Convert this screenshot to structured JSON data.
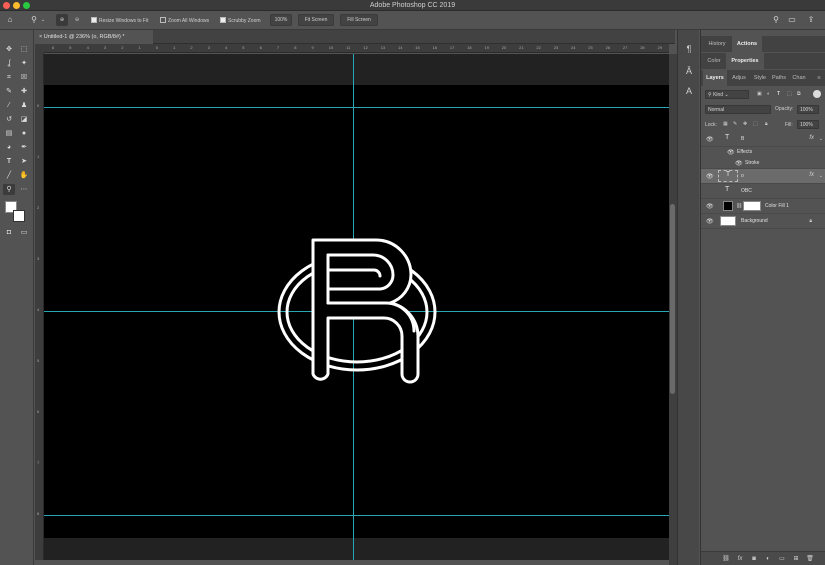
{
  "app": {
    "title": "Adobe Photoshop CC 2019"
  },
  "options_bar": {
    "resize_windows": {
      "label": "Resize Windows to Fit",
      "checked": true
    },
    "zoom_all": {
      "label": "Zoom All Windows",
      "checked": false
    },
    "scrubby_zoom": {
      "label": "Scrubby Zoom",
      "checked": true
    },
    "zoom_value": "100%",
    "fit_screen": "Fit Screen",
    "fill_screen": "Fill Screen"
  },
  "document": {
    "tab_title": "Untitled-1 @ 236% (o, RGB/8#) *"
  },
  "ruler": {
    "top": [
      "6",
      "5",
      "4",
      "3",
      "2",
      "1",
      "0",
      "1",
      "2",
      "3",
      "4",
      "5",
      "6",
      "7",
      "8",
      "9",
      "10",
      "11",
      "12",
      "13",
      "14",
      "15",
      "16",
      "17",
      "18",
      "19",
      "20",
      "21",
      "22",
      "23",
      "24",
      "25",
      "26",
      "27",
      "28",
      "29"
    ],
    "left": [
      "0",
      "1",
      "2",
      "3",
      "4",
      "5",
      "6",
      "7",
      "8",
      "9"
    ]
  },
  "top_panel": {
    "tabs": [
      "History",
      "Actions"
    ],
    "active": "Actions"
  },
  "mid_panel": {
    "tabs": [
      "Color",
      "Properties"
    ],
    "active": "Properties"
  },
  "layers_panel": {
    "tabs": [
      "Layers",
      "Adjus",
      "Style",
      "Paths",
      "Chan"
    ],
    "active": "Layers",
    "filter_kind": "Kind",
    "blend_mode": "Normal",
    "opacity_label": "Opacity:",
    "opacity_value": "100%",
    "lock_label": "Lock:",
    "fill_label": "Fill:",
    "fill_value": "100%",
    "layers": [
      {
        "name": "B",
        "type": "T",
        "fx": "fx",
        "visible": true,
        "selected": false
      },
      {
        "name": "Effects",
        "sub": true
      },
      {
        "name": "Stroke",
        "sub": true
      },
      {
        "name": "o",
        "type": "T",
        "fx": "fx",
        "visible": true,
        "selected": true
      },
      {
        "name": "OBC",
        "type": "T",
        "visible": false,
        "selected": false
      },
      {
        "name": "Color Fill 1",
        "visible": true,
        "selected": false
      },
      {
        "name": "Background",
        "visible": true,
        "selected": false
      }
    ]
  },
  "colors": {
    "canvas": "#000000",
    "guide": "#29a6b3",
    "foreground": "#ffffff",
    "background": "#ffffff"
  },
  "icons": {
    "home": "home-icon",
    "zoom": "zoom-tool-icon",
    "zoom_in": "zoom-in-icon",
    "zoom_out": "zoom-out-icon",
    "search": "search-icon",
    "workspace": "workspace-icon",
    "share": "share-icon"
  }
}
